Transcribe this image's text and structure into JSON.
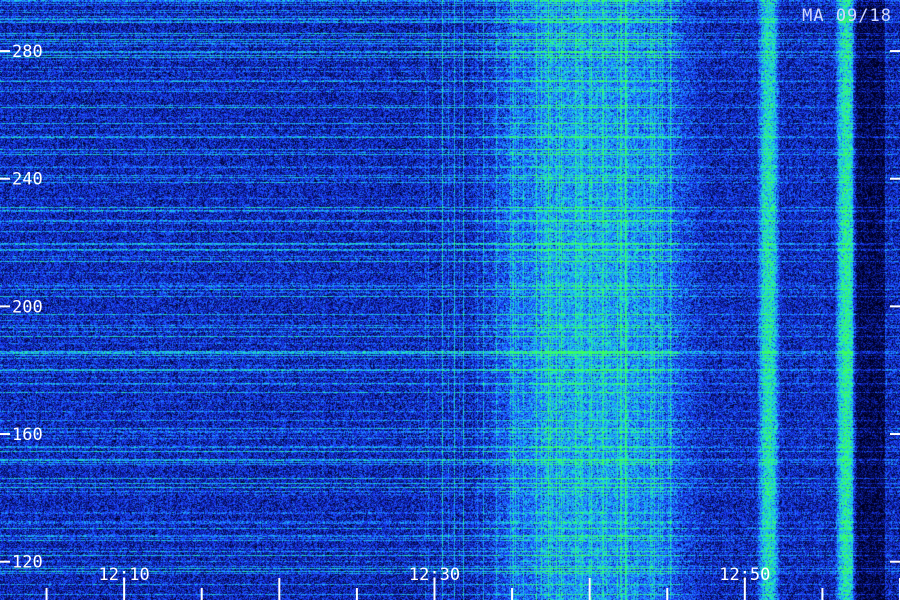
{
  "stamp": "MA 09/18",
  "chart_data": {
    "type": "heatmap",
    "title": "",
    "xlabel": "",
    "ylabel": "",
    "x_ticks": [
      "12:10",
      "12:30",
      "12:50"
    ],
    "y_ticks": [
      120,
      160,
      200,
      240,
      280
    ],
    "ylim": [
      108,
      296
    ],
    "xlim": [
      "12:02",
      "13:00"
    ],
    "colormap": [
      "#000022",
      "#0a1a8a",
      "#1c3cff",
      "#1ea0ff",
      "#1ee8c8",
      "#3cff5a"
    ],
    "bright_bands": [
      {
        "from": "12:51",
        "to": "12:52",
        "intensity": 0.9
      },
      {
        "from": "12:56",
        "to": "12:57",
        "intensity": 0.95
      },
      {
        "from": "12:35",
        "to": "12:45",
        "intensity": 0.55
      }
    ],
    "dark_band": {
      "from": "12:57",
      "to": "12:59"
    }
  }
}
